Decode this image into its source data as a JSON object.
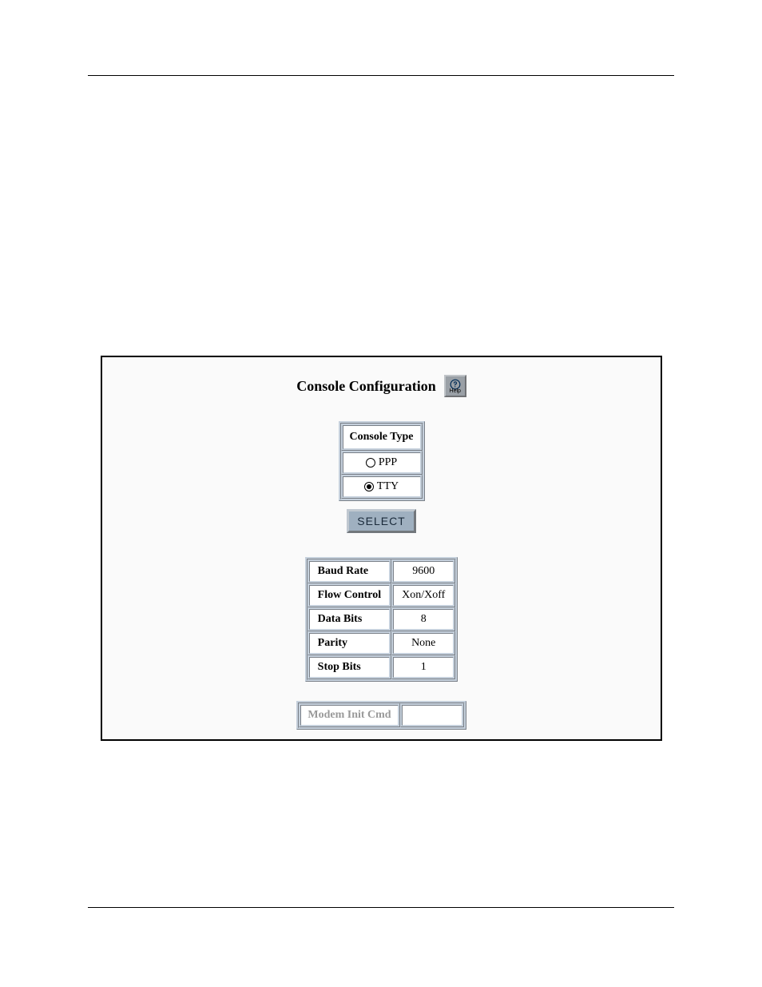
{
  "header": {
    "title": "Console Configuration",
    "help_label": "Help"
  },
  "console_type": {
    "header": "Console Type",
    "options": {
      "ppp": "PPP",
      "tty": "TTY"
    },
    "selected": "tty"
  },
  "select_button_label": "SELECT",
  "settings": {
    "rows": [
      {
        "label": "Baud Rate",
        "value": "9600"
      },
      {
        "label": "Flow Control",
        "value": "Xon/Xoff"
      },
      {
        "label": "Data Bits",
        "value": "8"
      },
      {
        "label": "Parity",
        "value": "None"
      },
      {
        "label": "Stop Bits",
        "value": "1"
      }
    ]
  },
  "modem": {
    "label": "Modem Init Cmd",
    "value": ""
  }
}
